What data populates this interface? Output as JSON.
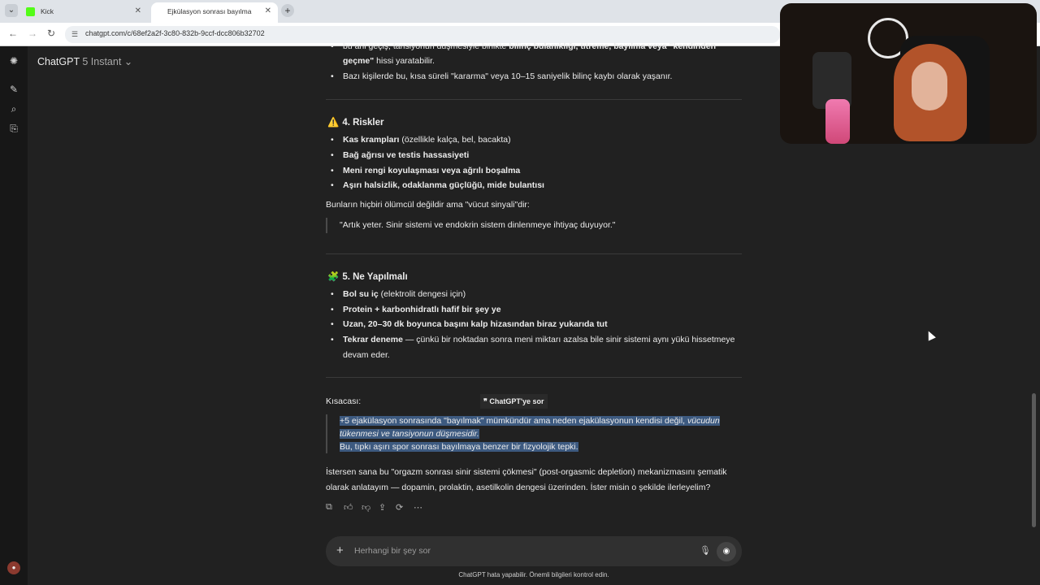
{
  "browser": {
    "tabs": [
      {
        "label": "Kick"
      },
      {
        "label": "Ejkülasyon sonrası bayılma"
      }
    ],
    "url": "chatgpt.com/c/68ef2a2f-3c80-832b-9ccf-dcc806b32702"
  },
  "header": {
    "model_name": "ChatGPT",
    "model_version": "5 Instant"
  },
  "content": {
    "top_fragment_line1_pre": "bu ani geçiş, tansiyonun düşmesiyle birlikte ",
    "top_fragment_line1_bold": "bilinç bulanıklığı, titreme, bayılma veya \"kendinden",
    "top_fragment_line2_bold": "geçme\"",
    "top_fragment_line2_rest": " hissi yaratabilir.",
    "top_bullet2": "Bazı kişilerde bu, kısa süreli \"kararma\" veya 10–15 saniyelik bilinç kaybı olarak yaşanır.",
    "section4": {
      "emoji": "⚠️",
      "title": "4. Riskler",
      "items": [
        {
          "bold": "Kas krampları",
          "rest": " (özellikle kalça, bel, bacakta)"
        },
        {
          "bold": "Bağ ağrısı ve testis hassasiyeti",
          "rest": ""
        },
        {
          "bold": "Meni rengi koyulaşması veya ağrılı boşalma",
          "rest": ""
        },
        {
          "bold": "Aşırı halsizlik, odaklanma güçlüğü, mide bulantısı",
          "rest": ""
        }
      ],
      "note": "Bunların hiçbiri ölümcül değildir ama \"vücut sinyali\"dir:",
      "quote": "\"Artık yeter. Sinir sistemi ve endokrin sistem dinlenmeye ihtiyaç duyuyor.\""
    },
    "section5": {
      "emoji": "🧩",
      "title": "5. Ne Yapılmalı",
      "items": [
        {
          "bold": "Bol su iç",
          "rest": " (elektrolit dengesi için)"
        },
        {
          "bold": "Protein + karbonhidratlı hafif bir şey ye",
          "rest": ""
        },
        {
          "bold": "Uzan, 20–30 dk boyunca başını kalp hizasından biraz yukarıda tut",
          "rest": ""
        },
        {
          "bold": "Tekrar deneme",
          "rest": " — çünkü bir noktadan sonra meni miktarı azalsa bile sinir sistemi aynı yükü hissetmeye"
        }
      ],
      "item4_line2": "devam eder."
    },
    "summary_label": "Kısacası:",
    "ask_chatgpt": "ChatGPT'ye sor",
    "summary_line1_pre": "+5 ejakülasyon sonrasında \"bayılmak\" mümkündür ama neden ejakülasyonun kendisi değil, ",
    "summary_line1_italic": "vücudun",
    "summary_line2_italic": "tükenmesi ve tansiyonun düşmesidir.",
    "summary_line3": "Bu, tıpkı aşırı spor sonrası bayılmaya benzer bir fizyolojik tepki.",
    "closing_line1": "İstersen sana bu \"orgazm sonrası sinir sistemi çökmesi\" (post-orgasmic depletion) mekanizmasını şematik",
    "closing_line2": "olarak anlatayım — dopamin, prolaktin, asetilkolin dengesi üzerinden. İster misin o şekilde ilerleyelim?"
  },
  "composer": {
    "placeholder": "Herhangi bir şey sor"
  },
  "disclaimer": "ChatGPT hata yapabilir. Önemli bilgileri kontrol edin."
}
